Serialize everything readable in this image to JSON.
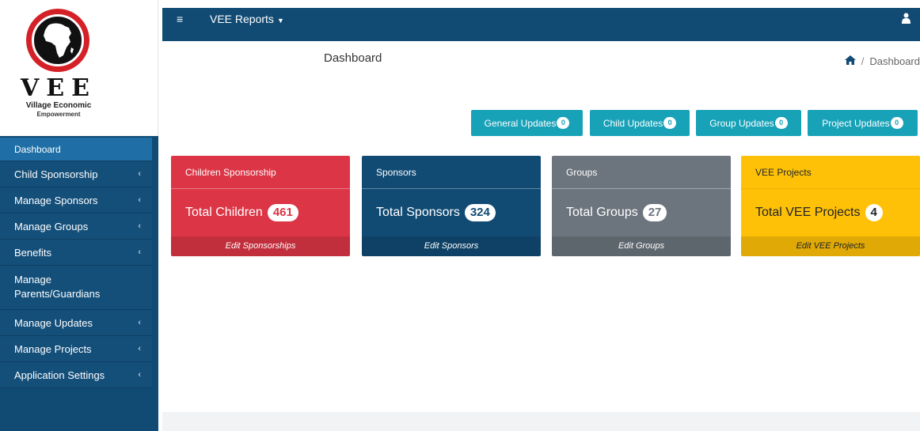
{
  "logo": {
    "title": "VEE",
    "subtitle_line1": "Village Economic",
    "subtitle_line2": "Empowerment"
  },
  "sidebar": {
    "items": [
      {
        "label": "Dashboard",
        "chevron": ""
      },
      {
        "label": "Child Sponsorship",
        "chevron": "‹"
      },
      {
        "label": "Manage Sponsors",
        "chevron": "‹"
      },
      {
        "label": "Manage Groups",
        "chevron": "‹"
      },
      {
        "label": "Benefits",
        "chevron": "‹"
      },
      {
        "label": "Manage Parents/Guardians",
        "chevron": ""
      },
      {
        "label": "Manage Updates",
        "chevron": "‹"
      },
      {
        "label": "Manage Projects",
        "chevron": "‹"
      },
      {
        "label": "Application Settings",
        "chevron": "‹"
      }
    ]
  },
  "topbar": {
    "menu_icon": "≡",
    "reports_label": "VEE Reports",
    "reports_caret": "▼",
    "user_icon": "user-icon"
  },
  "header": {
    "title": "Dashboard",
    "breadcrumb_home": "home-icon",
    "breadcrumb_sep": "/",
    "breadcrumb_current": "Dashboard"
  },
  "updates": [
    {
      "label": "General Updates",
      "count": "0"
    },
    {
      "label": "Child Updates",
      "count": "0"
    },
    {
      "label": "Group Updates",
      "count": "0"
    },
    {
      "label": "Project Updates",
      "count": "0"
    }
  ],
  "cards": [
    {
      "header": "Children Sponsorship",
      "text": "Total Children",
      "count": "461",
      "footer": "Edit Sponsorships",
      "color": "#dc3545"
    },
    {
      "header": "Sponsors",
      "text": "Total Sponsors",
      "count": "324",
      "footer": "Edit Sponsors",
      "color": "#114b74"
    },
    {
      "header": "Groups",
      "text": "Total Groups",
      "count": "27",
      "footer": "Edit Groups",
      "color": "#6c757d"
    },
    {
      "header": "VEE Projects",
      "text": "Total VEE Projects",
      "count": "4",
      "footer": "Edit VEE Projects",
      "color": "#ffc107"
    }
  ],
  "colors": {
    "navy": "#114b74",
    "info": "#17a2b8",
    "active_menu": "#1f6fa6"
  }
}
